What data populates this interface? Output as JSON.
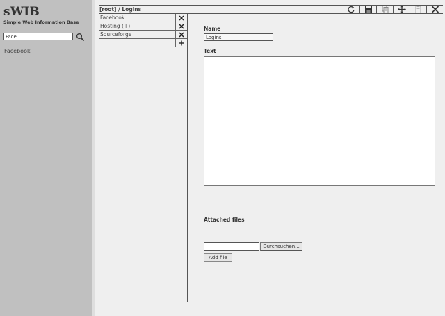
{
  "sidebar": {
    "app_title": "sWIB",
    "app_subtitle": "Simple Web Information Base",
    "search_value": "Face",
    "search_icon": "magnifier-icon",
    "results": [
      "Facebook"
    ]
  },
  "header": {
    "breadcrumb": "[root] / Logins",
    "toolbar": [
      {
        "icon": "refresh-icon",
        "enabled": true
      },
      {
        "icon": "save-icon",
        "enabled": true
      },
      {
        "icon": "copy-icon",
        "enabled": false
      },
      {
        "icon": "move-icon",
        "enabled": true
      },
      {
        "icon": "paste-icon",
        "enabled": false
      },
      {
        "icon": "close-icon",
        "enabled": true
      }
    ]
  },
  "children": {
    "items": [
      {
        "name": "Facebook"
      },
      {
        "name": "Hosting (+)"
      },
      {
        "name": "Sourceforge"
      }
    ],
    "delete_icon": "delete-icon",
    "add_icon": "plus-icon"
  },
  "editor": {
    "name_label": "Name",
    "name_value": "Logins",
    "text_label": "Text",
    "text_value": "",
    "attached_label": "Attached files",
    "browse_label": "Durchsuchen...",
    "add_file_label": "Add file"
  },
  "colors": {
    "sidebar_bg": "#c0c0c0",
    "main_bg": "#efefef",
    "line": "#555555"
  }
}
